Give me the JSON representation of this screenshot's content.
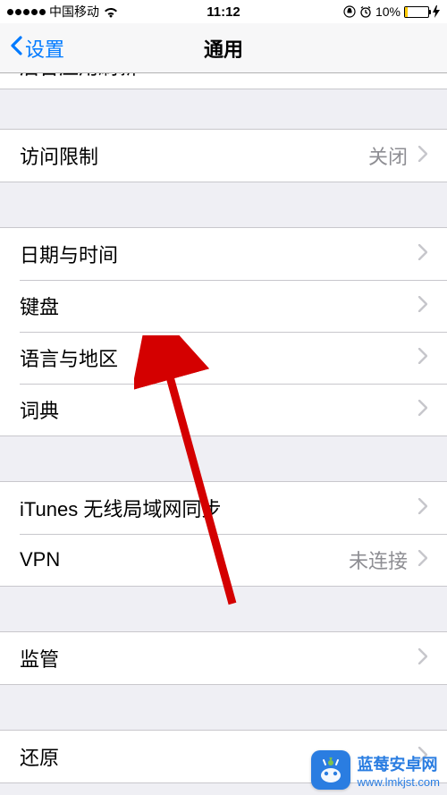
{
  "status": {
    "carrier": "中国移动",
    "time": "11:12",
    "battery_pct": "10%"
  },
  "nav": {
    "back_label": "设置",
    "title": "通用"
  },
  "rows": {
    "cutoff": "后台应用刷新",
    "restrictions": {
      "label": "访问限制",
      "value": "关闭"
    },
    "date_time": "日期与时间",
    "keyboard": "键盘",
    "language_region": "语言与地区",
    "dictionary": "词典",
    "itunes_wifi": "iTunes 无线局域网同步",
    "vpn": {
      "label": "VPN",
      "value": "未连接"
    },
    "supervision": "监管",
    "reset": "还原"
  },
  "watermark": {
    "title": "蓝莓安卓网",
    "url": "www.lmkjst.com"
  }
}
